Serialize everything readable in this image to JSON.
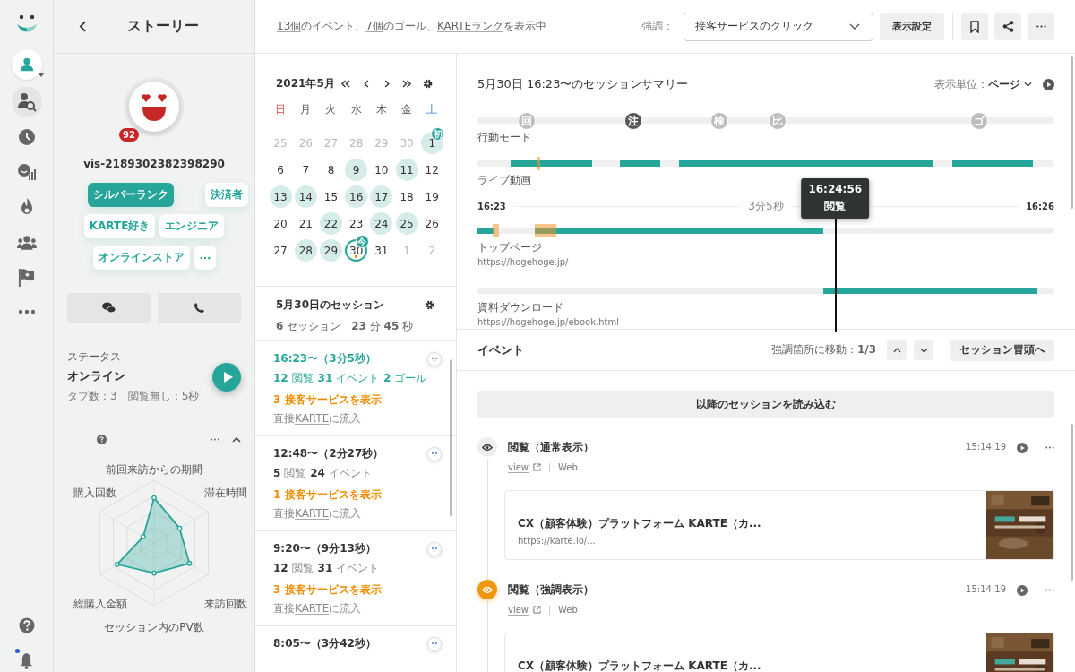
{
  "rail": {
    "notification": true
  },
  "profile": {
    "title": "ストーリー",
    "score": "92",
    "visitor_id": "vis-2189302382398290",
    "tags": [
      {
        "label": "シルバーランク",
        "primary": true
      },
      {
        "label": "決済者",
        "primary": false
      },
      {
        "label": "KARTE好き",
        "primary": false
      },
      {
        "label": "エンジニア",
        "primary": false
      },
      {
        "label": "オンラインストア",
        "primary": false
      }
    ],
    "status": {
      "label": "ステータス",
      "value": "オンライン",
      "detail": "タブ数：3　閲覧無し：5秒"
    },
    "radar": {
      "labels": [
        "前回来訪からの期間",
        "滞在時間",
        "来訪回数",
        "セッション内のPV数",
        "総購入金額",
        "購入回数"
      ]
    }
  },
  "top_bar": {
    "summary_parts": [
      {
        "text": "13個",
        "link": true
      },
      {
        "text": "のイベント、",
        "link": false
      },
      {
        "text": "7個",
        "link": true
      },
      {
        "text": "のゴール、",
        "link": false
      },
      {
        "text": "KARTEランク",
        "link": true
      },
      {
        "text": "を表示中",
        "link": false
      }
    ],
    "emphasis_label": "強調：",
    "emphasis_value": "接客サービスのクリック",
    "display_settings": "表示設定"
  },
  "calendar": {
    "title": "2021年5月",
    "weekdays": [
      {
        "label": "日",
        "kind": "sun"
      },
      {
        "label": "月",
        "kind": "weekday"
      },
      {
        "label": "火",
        "kind": "weekday"
      },
      {
        "label": "水",
        "kind": "weekday"
      },
      {
        "label": "木",
        "kind": "weekday"
      },
      {
        "label": "金",
        "kind": "weekday"
      },
      {
        "label": "土",
        "kind": "sat"
      }
    ],
    "days": [
      {
        "day": "25",
        "other_month": true,
        "visited": false,
        "today": false
      },
      {
        "day": "26",
        "other_month": true,
        "visited": false,
        "today": false
      },
      {
        "day": "27",
        "other_month": true,
        "visited": false,
        "today": false
      },
      {
        "day": "28",
        "other_month": true,
        "visited": false,
        "today": false
      },
      {
        "day": "29",
        "other_month": true,
        "visited": false,
        "today": false
      },
      {
        "day": "30",
        "other_month": true,
        "visited": false,
        "today": false
      },
      {
        "day": "1",
        "other_month": false,
        "visited": true,
        "today": false,
        "badge": "初"
      },
      {
        "day": "6",
        "other_month": false,
        "visited": false,
        "today": false
      },
      {
        "day": "7",
        "other_month": false,
        "visited": false,
        "today": false
      },
      {
        "day": "8",
        "other_month": false,
        "visited": false,
        "today": false
      },
      {
        "day": "9",
        "other_month": false,
        "visited": true,
        "today": false
      },
      {
        "day": "10",
        "other_month": false,
        "visited": false,
        "today": false
      },
      {
        "day": "11",
        "other_month": false,
        "visited": true,
        "today": false
      },
      {
        "day": "12",
        "other_month": false,
        "visited": false,
        "today": false
      },
      {
        "day": "13",
        "other_month": false,
        "visited": true,
        "today": false
      },
      {
        "day": "14",
        "other_month": false,
        "visited": true,
        "today": false
      },
      {
        "day": "15",
        "other_month": false,
        "visited": false,
        "today": false
      },
      {
        "day": "16",
        "other_month": false,
        "visited": true,
        "today": false
      },
      {
        "day": "17",
        "other_month": false,
        "visited": true,
        "today": false
      },
      {
        "day": "18",
        "other_month": false,
        "visited": false,
        "today": false
      },
      {
        "day": "19",
        "other_month": false,
        "visited": false,
        "today": false
      },
      {
        "day": "20",
        "other_month": false,
        "visited": false,
        "today": false
      },
      {
        "day": "21",
        "other_month": false,
        "visited": false,
        "today": false
      },
      {
        "day": "22",
        "other_month": false,
        "visited": true,
        "today": false
      },
      {
        "day": "23",
        "other_month": false,
        "visited": false,
        "today": false
      },
      {
        "day": "24",
        "other_month": false,
        "visited": true,
        "today": false
      },
      {
        "day": "25",
        "other_month": false,
        "visited": true,
        "today": false
      },
      {
        "day": "26",
        "other_month": false,
        "visited": false,
        "today": false
      },
      {
        "day": "27",
        "other_month": false,
        "visited": false,
        "today": false
      },
      {
        "day": "28",
        "other_month": false,
        "visited": true,
        "today": false
      },
      {
        "day": "29",
        "other_month": false,
        "visited": true,
        "today": false
      },
      {
        "day": "30",
        "other_month": false,
        "visited": false,
        "today": true,
        "badge": "今"
      },
      {
        "day": "31",
        "other_month": false,
        "visited": false,
        "today": false
      },
      {
        "day": "1",
        "other_month": true,
        "visited": false,
        "today": false
      },
      {
        "day": "2",
        "other_month": true,
        "visited": false,
        "today": false
      }
    ]
  },
  "sessions": {
    "title": "5月30日のセッション",
    "summary": "**6** セッション　**23** 分 **45** 秒",
    "items": [
      {
        "time": "16:23〜（3分5秒）",
        "selected": true,
        "stats": [
          {
            "n": "12",
            "unit": "閲覧"
          },
          {
            "n": "31",
            "unit": "イベント"
          },
          {
            "n": "2",
            "unit": "ゴール"
          }
        ],
        "services": "3 接客サービスを表示",
        "source_before": "直接",
        "source_link": "KARTE",
        "source_after": "に流入"
      },
      {
        "time": "12:48〜（2分27秒）",
        "selected": false,
        "stats": [
          {
            "n": "5",
            "unit": "閲覧"
          },
          {
            "n": "24",
            "unit": "イベント"
          }
        ],
        "services": "1 接客サービスを表示",
        "source_before": "直接",
        "source_link": "KARTE",
        "source_after": "に流入"
      },
      {
        "time": "9:20〜（9分13秒）",
        "selected": false,
        "stats": [
          {
            "n": "12",
            "unit": "閲覧"
          },
          {
            "n": "31",
            "unit": "イベント"
          }
        ],
        "services": "3 接客サービスを表示",
        "source_before": "直接",
        "source_link": "KARTE",
        "source_after": "に流入"
      },
      {
        "time": "8:05〜（3分42秒）",
        "selected": false
      }
    ]
  },
  "summary": {
    "title": "5月30日 16:23〜のセッションサマリー",
    "unit_label": "表示単位：",
    "unit": "ページ",
    "mode_track": {
      "label": "行動モード",
      "markers": [
        {
          "char": "回",
          "selected": false
        },
        {
          "char": "注",
          "selected": true
        },
        {
          "char": "検",
          "selected": false
        },
        {
          "char": "比",
          "selected": false
        },
        {
          "char": "ゴ",
          "selected": false
        }
      ]
    },
    "live_track": {
      "label": "ライブ動画"
    },
    "axis": {
      "start": "16:23",
      "duration": "3分5秒",
      "end": "16:26"
    },
    "pages": [
      {
        "title": "トップページ",
        "url": "https://hogehoge.jp/"
      },
      {
        "title": "資料ダウンロード",
        "url": "https://hogehoge.jp/ebook.html"
      }
    ],
    "tooltip": {
      "time": "16:24:56",
      "label": "閲覧"
    }
  },
  "events": {
    "title": "イベント",
    "jump": "強調箇所に移動：**1/3**",
    "to_start": "セッション冒頭へ",
    "load_more": "以降のセッションを読み込む",
    "items": [
      {
        "kind": "normal",
        "title": "閲覧（通常表示）",
        "link": "view",
        "source": "Web",
        "time": "15:14:19",
        "card_title": "CX（顧客体験）プラットフォーム KARTE（カ...",
        "card_url": "https://karte.io/..."
      },
      {
        "kind": "highlight",
        "title": "閲覧（強調表示）",
        "link": "view",
        "source": "Web",
        "time": "15:14:19",
        "card_title": "CX（顧客体験）プラットフォーム KARTE（カ..."
      }
    ]
  }
}
